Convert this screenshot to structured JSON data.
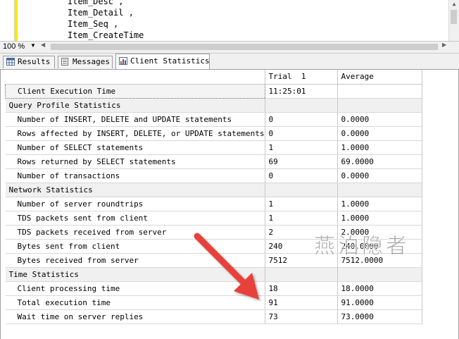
{
  "editor": {
    "lines": [
      "Item_Desc ,",
      "Item_Detail ,",
      "Item_Seq ,",
      "Item_CreateTime"
    ]
  },
  "zoom": {
    "value": "100 %"
  },
  "tabs": [
    {
      "label": "Results",
      "icon": "grid-icon"
    },
    {
      "label": "Messages",
      "icon": "messages-icon"
    },
    {
      "label": "Client Statistics",
      "icon": "statistics-icon"
    }
  ],
  "grid": {
    "headers": {
      "trial": "Trial  1",
      "average": "Average"
    },
    "arrow": "→",
    "rows": [
      {
        "kind": "first",
        "label": "Client Execution Time",
        "trial": "11:25:01",
        "average": ""
      },
      {
        "kind": "group",
        "label": "Query Profile Statistics",
        "trial": "",
        "average": ""
      },
      {
        "kind": "item",
        "label": "Number of INSERT, DELETE and UPDATE statements",
        "trial": "0",
        "average": "0.0000"
      },
      {
        "kind": "item",
        "label": "Rows affected by INSERT, DELETE, or UPDATE statements",
        "trial": "0",
        "average": "0.0000"
      },
      {
        "kind": "item",
        "label": "Number of SELECT statements",
        "trial": "1",
        "average": "1.0000"
      },
      {
        "kind": "item",
        "label": "Rows returned by SELECT statements",
        "trial": "69",
        "average": "69.0000"
      },
      {
        "kind": "item",
        "label": "Number of transactions",
        "trial": "0",
        "average": "0.0000"
      },
      {
        "kind": "group",
        "label": "Network Statistics",
        "trial": "",
        "average": ""
      },
      {
        "kind": "item",
        "label": "Number of server roundtrips",
        "trial": "1",
        "average": "1.0000"
      },
      {
        "kind": "item",
        "label": "TDS packets sent from client",
        "trial": "1",
        "average": "1.0000"
      },
      {
        "kind": "item",
        "label": "TDS packets received from server",
        "trial": "2",
        "average": "2.0000"
      },
      {
        "kind": "item",
        "label": "Bytes sent from client",
        "trial": "240",
        "average": "240.0000"
      },
      {
        "kind": "item",
        "label": "Bytes received from server",
        "trial": "7512",
        "average": "7512.0000"
      },
      {
        "kind": "group",
        "label": "Time Statistics",
        "trial": "",
        "average": ""
      },
      {
        "kind": "item",
        "label": "Client processing time",
        "trial": "18",
        "average": "18.0000"
      },
      {
        "kind": "item",
        "label": "Total execution time",
        "trial": "91",
        "average": "91.0000"
      },
      {
        "kind": "item",
        "label": "Wait time on server replies",
        "trial": "73",
        "average": "73.0000"
      }
    ]
  },
  "watermark": {
    "text": "燕泊隐者"
  },
  "colors": {
    "annotation_arrow": "#e8413a",
    "editor_margin": "#ffe600",
    "group_row": "#f0f0f0"
  }
}
